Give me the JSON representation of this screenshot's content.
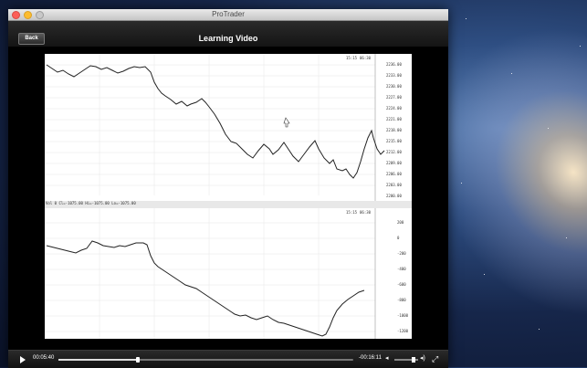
{
  "window": {
    "title": "ProTrader"
  },
  "navbar": {
    "back_label": "Back",
    "title": "Learning Video"
  },
  "chart_top": {
    "header_left": "",
    "time_label": "15:15",
    "time_label2": "06:30",
    "y_labels": [
      "2236.00",
      "2233.00",
      "2230.00",
      "2227.00",
      "2224.00",
      "2221.00",
      "2218.00",
      "2215.00",
      "2212.00",
      "2209.00",
      "2206.00",
      "2203.00",
      "2200.00"
    ]
  },
  "separator": {
    "label": "Vol 0  Cl=-1075.00  Hi=-1075.00  Lo=-1075.00"
  },
  "chart_bottom": {
    "time_label": "15:15",
    "time_label2": "06:30",
    "y_labels": [
      "200",
      "0",
      "-200",
      "-400",
      "-600",
      "-800",
      "-1000",
      "-1200"
    ]
  },
  "controls": {
    "current_time": "00:05:40",
    "remaining_time": "-00:16:11",
    "progress": 0.27,
    "volume": 0.8
  },
  "colors": {
    "accent": "#ffffff",
    "background": "#000000"
  }
}
